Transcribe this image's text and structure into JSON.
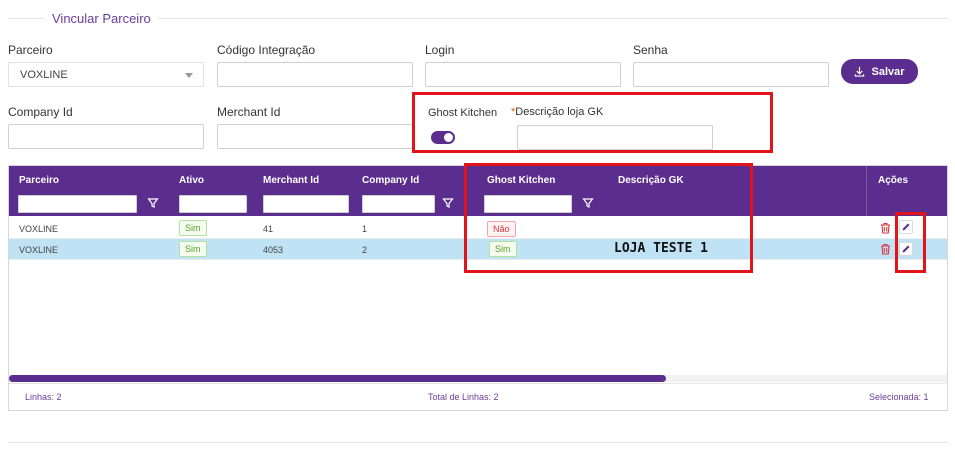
{
  "section": {
    "title": "Vincular Parceiro"
  },
  "form": {
    "parceiro_label": "Parceiro",
    "parceiro_value": "VOXLINE",
    "codigo_label": "Código Integração",
    "codigo_value": "",
    "login_label": "Login",
    "login_value": "",
    "senha_label": "Senha",
    "senha_value": "",
    "save_label": "Salvar",
    "company_label": "Company Id",
    "company_value": "",
    "merchant_label": "Merchant Id",
    "merchant_value": "",
    "ghost_label": "Ghost Kitchen",
    "ghost_on": true,
    "descricao_required_mark": "*",
    "descricao_label": "Descrição loja GK",
    "descricao_value": ""
  },
  "grid": {
    "columns": [
      "Parceiro",
      "Ativo",
      "Merchant Id",
      "Company Id",
      "Ghost Kitchen",
      "Descrição GK",
      "Ações"
    ],
    "rows": [
      {
        "parceiro": "VOXLINE",
        "ativo": "Sim",
        "merchant": "41",
        "company": "1",
        "ghost": "Não",
        "descricao": ""
      },
      {
        "parceiro": "VOXLINE",
        "ativo": "Sim",
        "merchant": "4053",
        "company": "2",
        "ghost": "Sim",
        "descricao": "LOJA TESTE 1"
      }
    ],
    "selected_row": 1,
    "footer": {
      "linhas": "Linhas: 2",
      "total": "Total de Linhas: 2",
      "selecionada": "Selecionada: 1"
    }
  },
  "colors": {
    "primary": "#5b2d8e",
    "highlight": "#e1141c",
    "selected_row": "#bfe3f5"
  }
}
